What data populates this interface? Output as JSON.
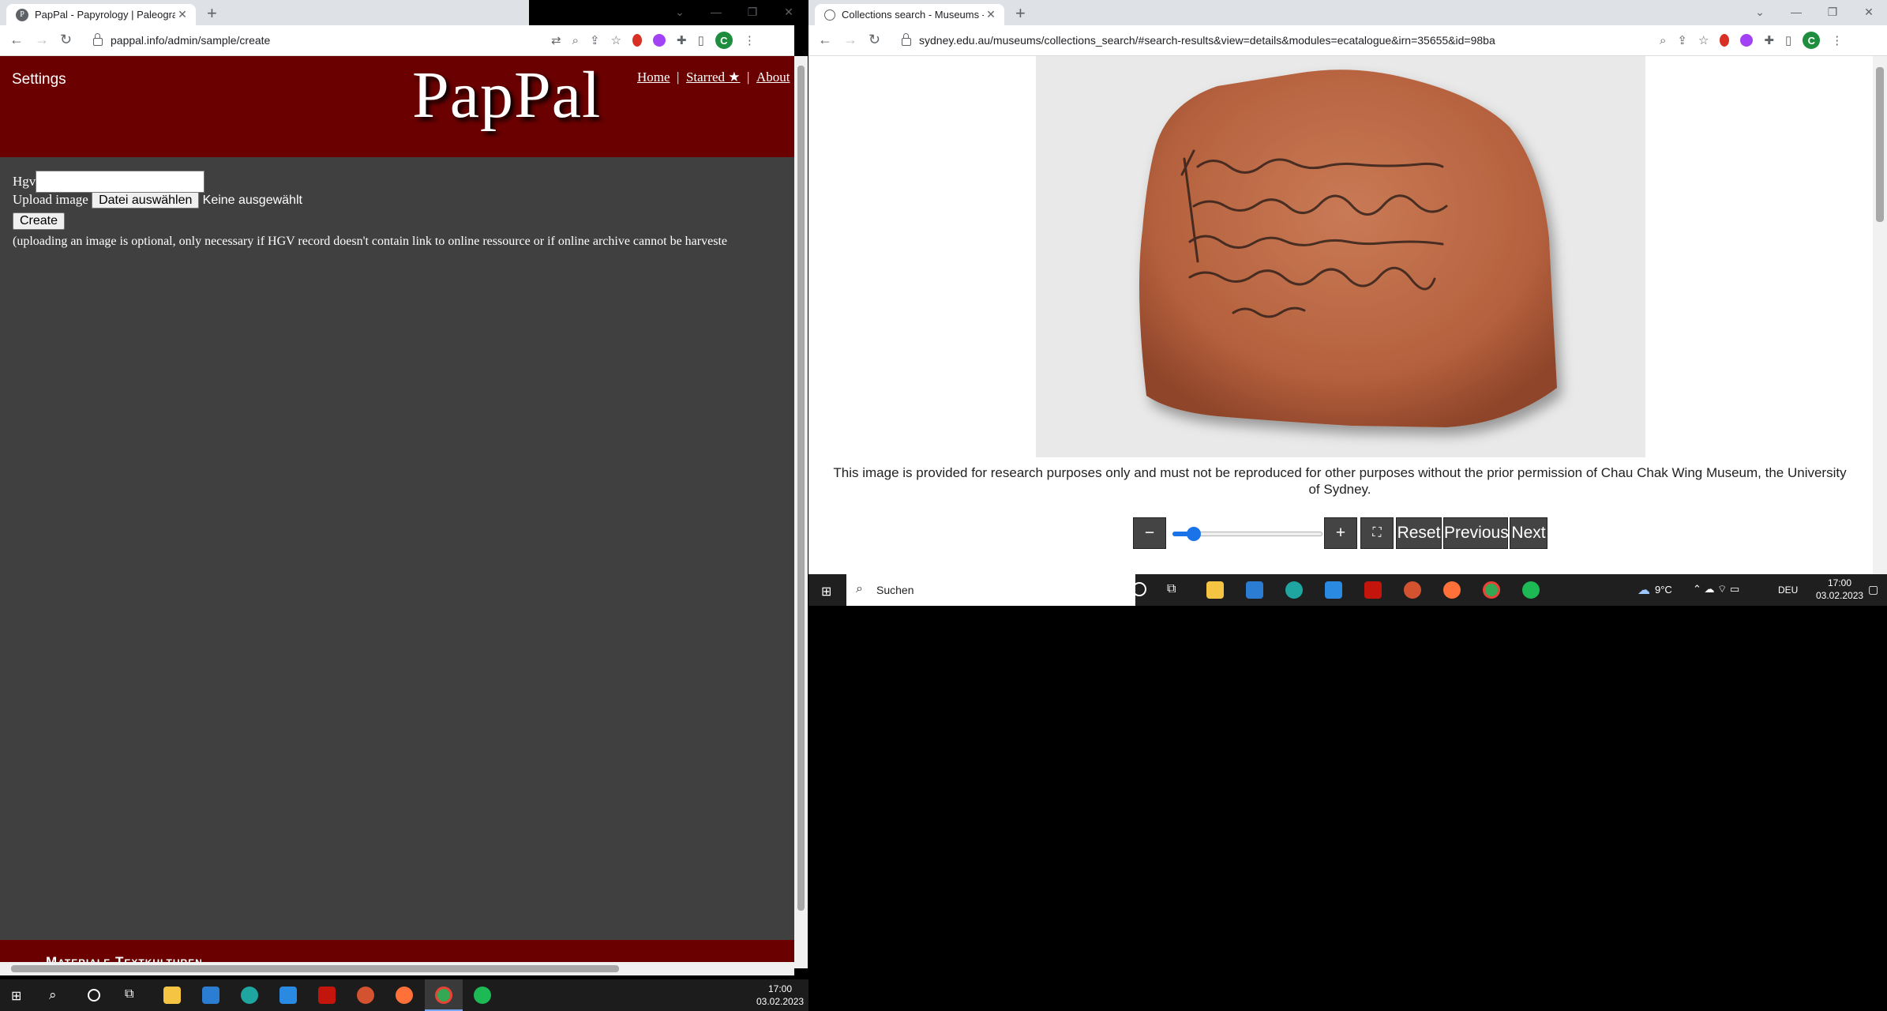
{
  "left_browser": {
    "tab_title": "PapPal - Papyrology | Paleograph",
    "favicon_letter": "P",
    "url": "pappal.info/admin/sample/create",
    "page": {
      "settings_label": "Settings",
      "logo": "PapPal",
      "links": {
        "home": "Home",
        "starred": "Starred ★",
        "about": "About"
      },
      "hgv_label": "Hgv",
      "upload_label": "Upload image",
      "file_button": "Datei auswählen",
      "file_status": "Keine ausgewählt",
      "create_button": "Create",
      "note": "(uploading an image is optional, only necessary if HGV record doesn't contain link to online ressource or if online archive cannot be harveste",
      "footer_text": "Materiale Textkulturen"
    }
  },
  "right_browser": {
    "tab_title": "Collections search - Museums - T",
    "url": "sydney.edu.au/museums/collections_search/#search-results&view=details&modules=ecatalogue&irn=35655&id=98ba",
    "disclaimer": "This image is provided for research purposes only and must not be reproduced for other purposes without the prior permission of Chau Chak Wing Museum, the University of Sydney.",
    "viewer": {
      "minus": "−",
      "plus": "+",
      "fullscreen": "⛶",
      "reset": "Reset",
      "previous": "Previous",
      "next": "Next",
      "zoom_level": 0.15
    }
  },
  "small_taskbar": {
    "search_placeholder": "Suchen",
    "weather": "9°C",
    "lang": "DEU",
    "time": "17:00",
    "date": "03.02.2023"
  },
  "main_taskbar": {
    "time": "17:00",
    "date": "03.02.2023"
  },
  "colors": {
    "header_red": "#6b0000",
    "page_gray": "#404040",
    "accent_blue": "#1a73e8"
  }
}
